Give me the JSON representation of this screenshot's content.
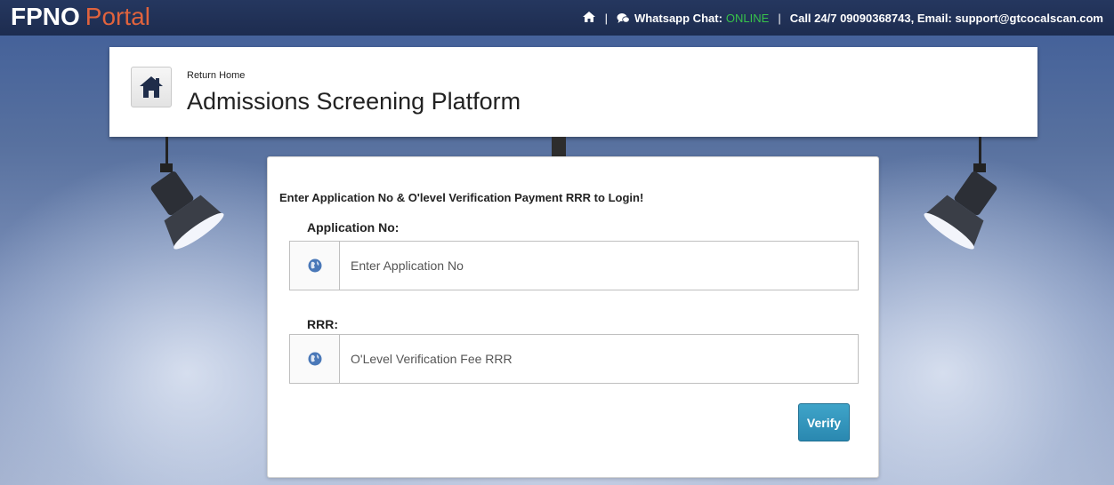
{
  "topbar": {
    "brand_primary": "FPNO",
    "brand_secondary": "Portal",
    "separator": "|",
    "whatsapp_label": "Whatsapp Chat:",
    "online_status": "ONLINE",
    "contact_text": "Call 24/7  09090368743, Email: support@gtcocalscan.com",
    "icons": [
      "home-icon",
      "chat-icon"
    ]
  },
  "header": {
    "return_home": "Return Home",
    "title": "Admissions Screening Platform"
  },
  "login": {
    "intro": "Enter Application No & O'level Verification Payment RRR to Login!",
    "application_label": "Application No:",
    "application_placeholder": "Enter Application No",
    "application_value": "",
    "rrr_label": "RRR:",
    "rrr_placeholder": "O'Level Verification Fee RRR",
    "rrr_value": "",
    "verify_label": "Verify",
    "icons": [
      "globe-icon",
      "globe-icon"
    ]
  },
  "colors": {
    "brand_accent": "#e0633d",
    "online": "#37c24a",
    "topbar": "#1d2c4f",
    "verify_button": "#2a88b0"
  }
}
